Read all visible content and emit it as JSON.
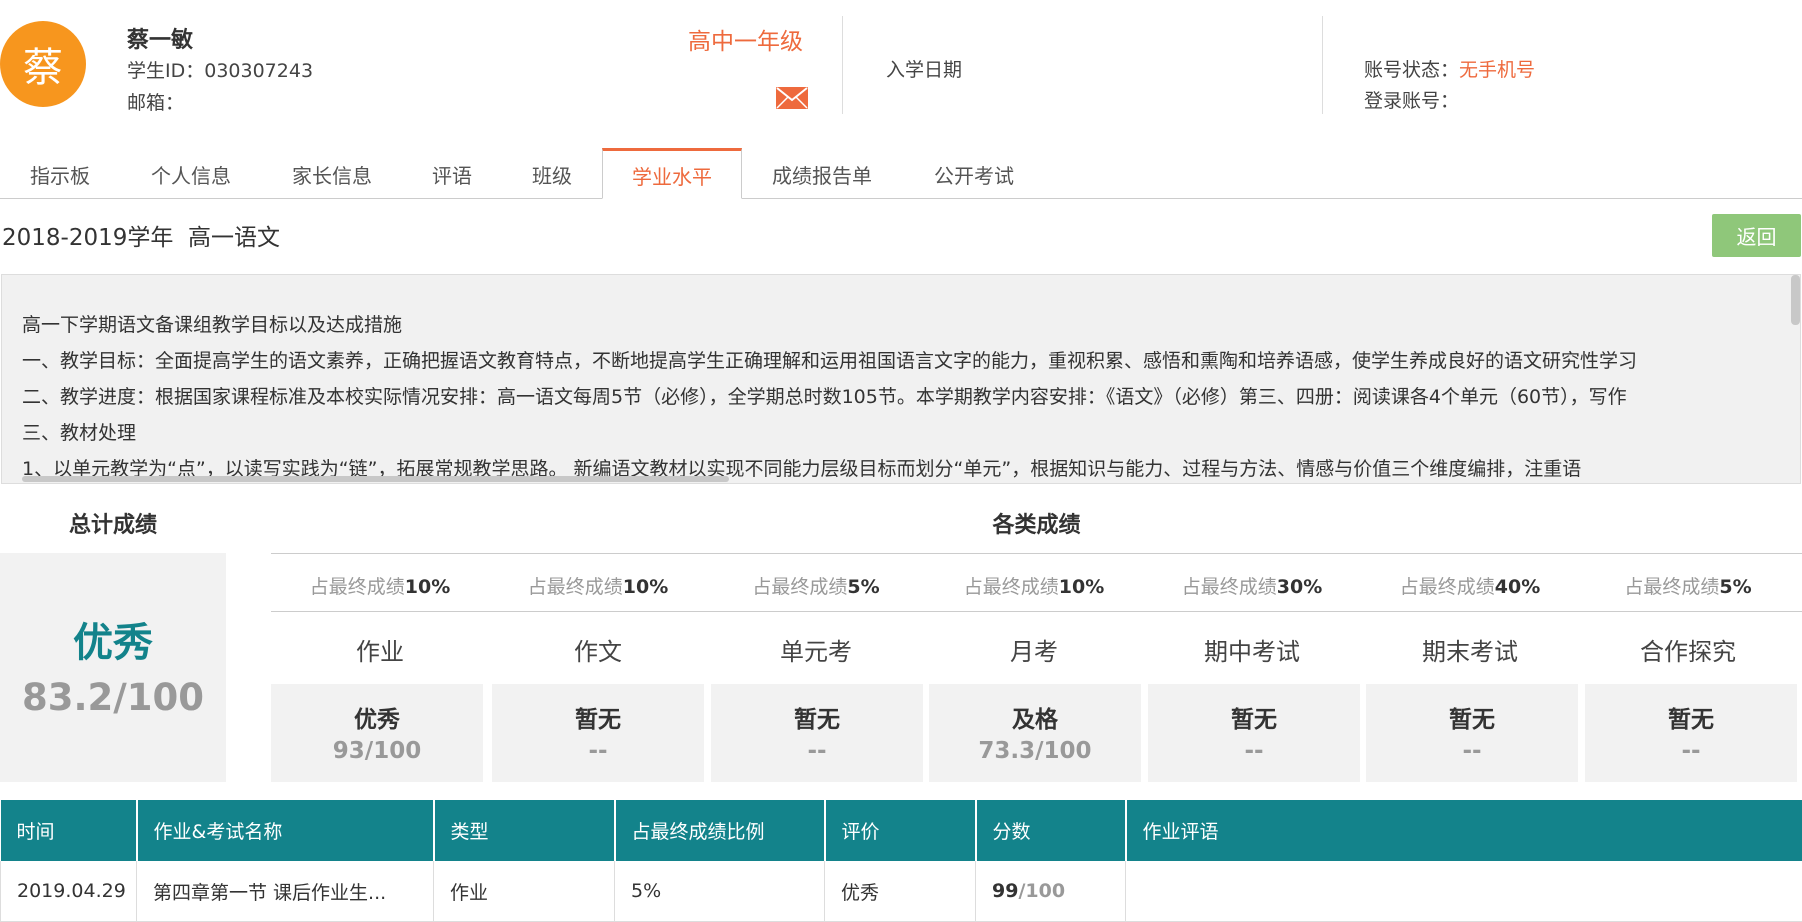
{
  "student": {
    "avatar_char": "蔡",
    "name": "蔡一敏",
    "id_label": "学生ID：",
    "id_value": "030307243",
    "email_label": "邮箱：",
    "grade": "高中一年级",
    "enroll_label": "入学日期",
    "status_label": "账号状态：",
    "status_value": "无手机号",
    "login_label": "登录账号："
  },
  "tabs": [
    {
      "label": "指示板"
    },
    {
      "label": "个人信息"
    },
    {
      "label": "家长信息"
    },
    {
      "label": "评语"
    },
    {
      "label": "班级"
    },
    {
      "label": "学业水平",
      "active": true
    },
    {
      "label": "成绩报告单"
    },
    {
      "label": "公开考试"
    }
  ],
  "page": {
    "title": "2018-2019学年  高一语文",
    "back_label": "返回"
  },
  "panel": {
    "lines": [
      "高一下学期语文备课组教学目标以及达成措施",
      "一、教学目标：全面提高学生的语文素养，正确把握语文教育特点，不断地提高学生正确理解和运用祖国语言文字的能力，重视积累、感悟和熏陶和培养语感，使学生养成良好的语文研究性学习",
      "二、教学进度：根据国家课程标准及本校实际情况安排：高一语文每周5节（必修），全学期总时数105节。本学期教学内容安排：《语文》（必修）第三、四册：阅读课各4个单元（60节），写作",
      "三、教材处理",
      "1、以单元教学为“点”，以读写实践为“链”，拓展常规教学思路。 新编语文教材以实现不同能力层级目标而划分“单元”，根据知识与能力、过程与方法、情感与价值三个维度编排，注重语"
    ]
  },
  "scores": {
    "total_title": "总计成绩",
    "total_grade": "优秀",
    "total_score": "83.2/100",
    "category_title": "各类成绩",
    "pct_prefix": "占最终成绩",
    "categories": [
      {
        "name": "作业",
        "pct": "10%",
        "grade": "优秀",
        "score": "93/100"
      },
      {
        "name": "作文",
        "pct": "10%",
        "grade": "暂无",
        "score": "--"
      },
      {
        "name": "单元考",
        "pct": "5%",
        "grade": "暂无",
        "score": "--"
      },
      {
        "name": "月考",
        "pct": "10%",
        "grade": "及格",
        "score": "73.3/100"
      },
      {
        "name": "期中考试",
        "pct": "30%",
        "grade": "暂无",
        "score": "--"
      },
      {
        "name": "期末考试",
        "pct": "40%",
        "grade": "暂无",
        "score": "--"
      },
      {
        "name": "合作探究",
        "pct": "5%",
        "grade": "暂无",
        "score": "--"
      }
    ]
  },
  "table": {
    "headers": [
      "时间",
      "作业&考试名称",
      "类型",
      "占最终成绩比例",
      "评价",
      "分数",
      "作业评语"
    ],
    "rows": [
      {
        "time": "2019.04.29",
        "name": "第四章第一节 课后作业生...",
        "type": "作业",
        "ratio": "5%",
        "eval": "优秀",
        "score": "99",
        "score_total": "/100",
        "comment": ""
      }
    ]
  },
  "colors": {
    "accent": "#ee6a3d",
    "teal": "#13838b",
    "back_button": "#8fc77a",
    "avatar": "#f7961e"
  }
}
